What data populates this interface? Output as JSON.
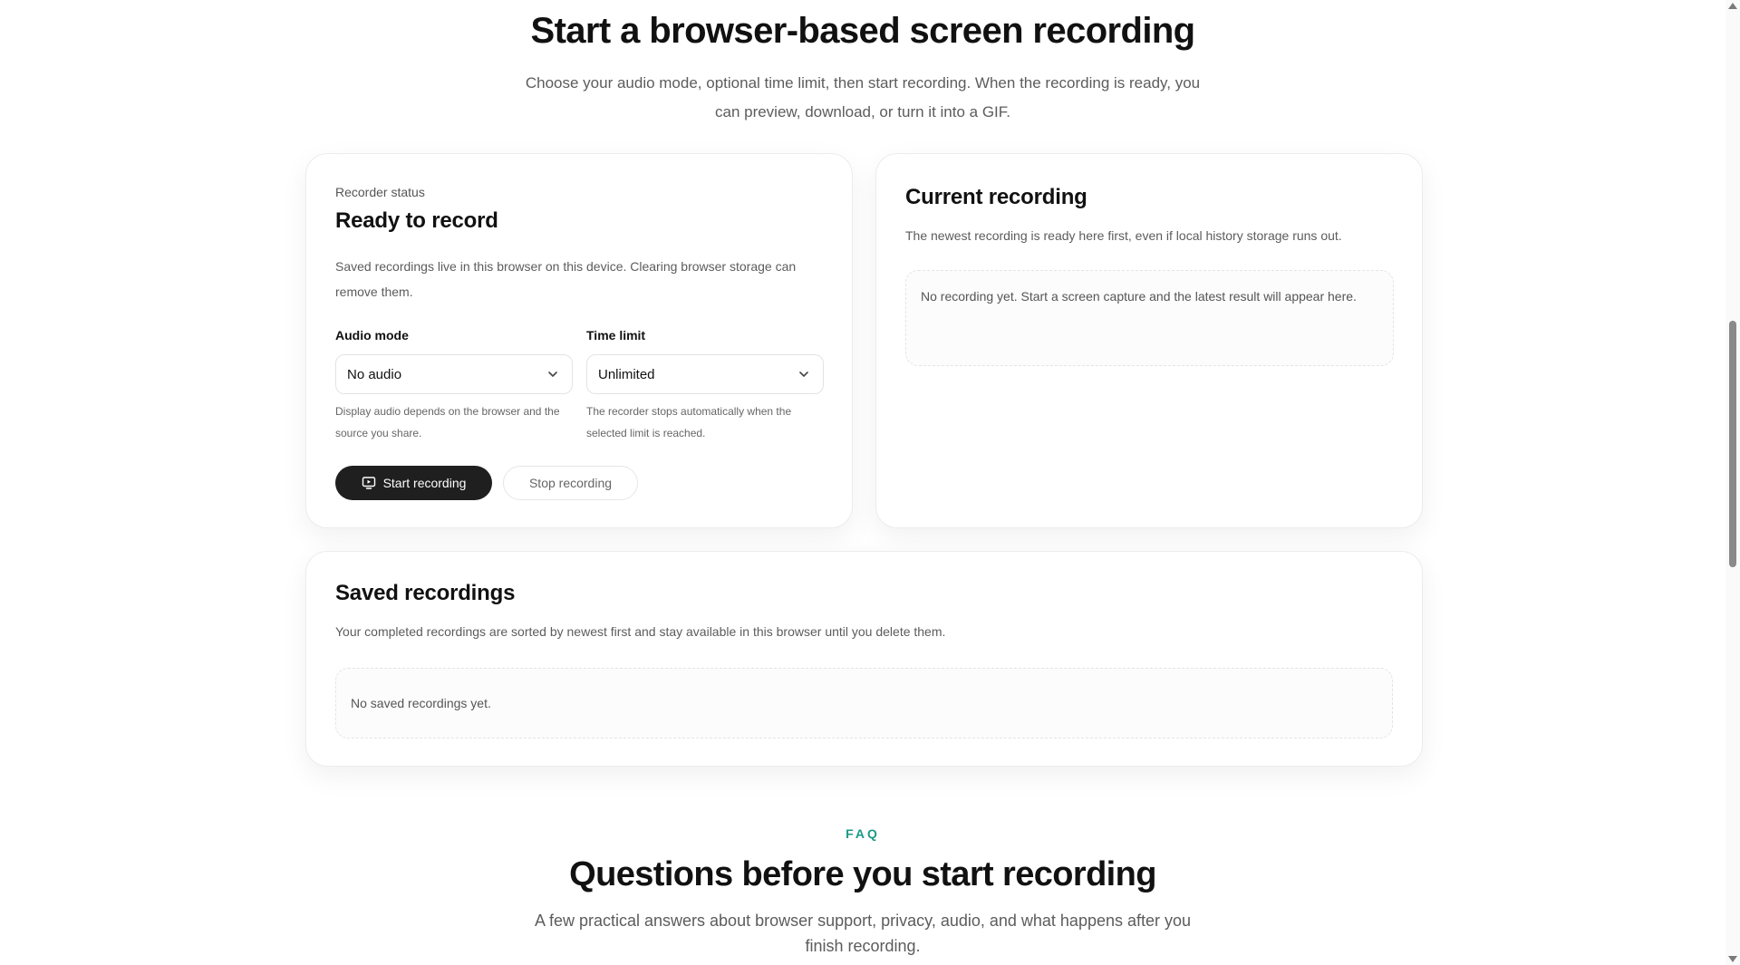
{
  "hero": {
    "title": "Start a browser-based screen recording",
    "subtitle": "Choose your audio mode, optional time limit, then start recording. When the recording is ready, you can preview, download, or turn it into a GIF."
  },
  "recorder": {
    "eyebrow": "Recorder status",
    "title": "Ready to record",
    "description": "Saved recordings live in this browser on this device. Clearing browser storage can remove them.",
    "audio_label": "Audio mode",
    "audio_value": "No audio",
    "audio_hint": "Display audio depends on the browser and the source you share.",
    "time_label": "Time limit",
    "time_value": "Unlimited",
    "time_hint": "The recorder stops automatically when the selected limit is reached.",
    "start_label": "Start recording",
    "stop_label": "Stop recording",
    "start_icon": "screen-record-icon"
  },
  "current": {
    "title": "Current recording",
    "description": "The newest recording is ready here first, even if local history storage runs out.",
    "empty": "No recording yet. Start a screen capture and the latest result will appear here."
  },
  "saved": {
    "title": "Saved recordings",
    "description": "Your completed recordings are sorted by newest first and stay available in this browser until you delete them.",
    "empty": "No saved recordings yet."
  },
  "faq": {
    "eyebrow": "FAQ",
    "title": "Questions before you start recording",
    "subtitle": "A few practical answers about browser support, privacy, audio, and what happens after you finish recording."
  },
  "colors": {
    "accent": "#1a9a86",
    "primary_button": "#1f1f1f"
  }
}
